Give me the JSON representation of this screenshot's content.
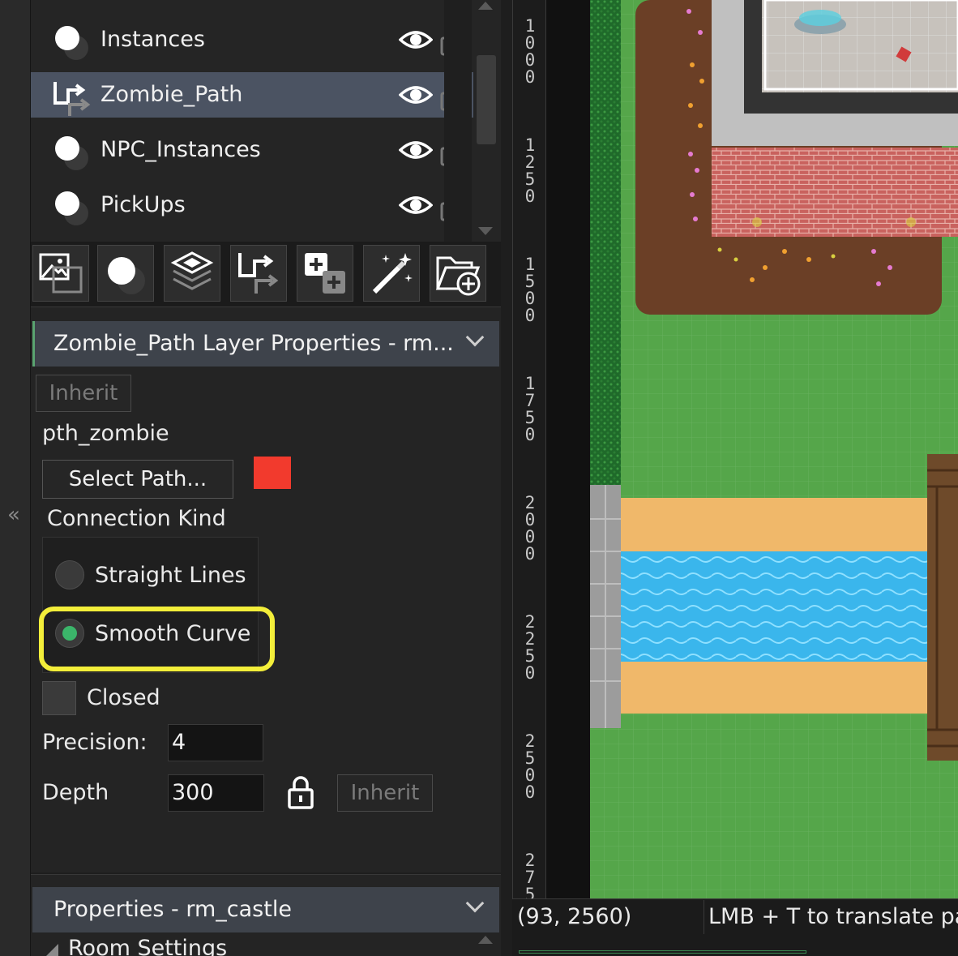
{
  "layers": [
    {
      "name": "Instances",
      "type": "instance",
      "selected": false
    },
    {
      "name": "Zombie_Path",
      "type": "path",
      "selected": true
    },
    {
      "name": "NPC_Instances",
      "type": "instance",
      "selected": false
    },
    {
      "name": "PickUps",
      "type": "instance",
      "selected": false
    }
  ],
  "toolbar_icons": [
    "image-layer-icon",
    "instance-layer-icon",
    "tile-layer-icon",
    "path-layer-icon",
    "add-layer-icon",
    "effect-layer-icon",
    "add-folder-icon"
  ],
  "layer_properties": {
    "title": "Zombie_Path Layer Properties - rm...",
    "inherit_label": "Inherit",
    "path_name": "pth_zombie",
    "select_path_label": "Select Path...",
    "path_color": "#f23a2d",
    "connection_kind_label": "Connection Kind",
    "options": [
      {
        "label": "Straight Lines",
        "selected": false
      },
      {
        "label": "Smooth Curve",
        "selected": true
      }
    ],
    "closed_label": "Closed",
    "precision_label": "Precision:",
    "precision_value": "4",
    "depth_label": "Depth",
    "depth_value": "300",
    "depth_inherit_label": "Inherit"
  },
  "room_properties": {
    "title": "Properties - rm_castle",
    "section": "Room Settings"
  },
  "ruler_labels": [
    "1\n0\n0\n0",
    "1\n2\n5\n0",
    "1\n5\n0\n0",
    "1\n7\n5\n0",
    "2\n0\n0\n0",
    "2\n2\n5\n0",
    "2\n5\n0\n0",
    "2\n7\n5"
  ],
  "status": {
    "coords": "(93, 2560)",
    "hint": "LMB + T to translate pat"
  },
  "colors": {
    "accent_green": "#3bb56a",
    "highlight_yellow": "#f3ee3a",
    "selected_row": "#4b5362"
  }
}
